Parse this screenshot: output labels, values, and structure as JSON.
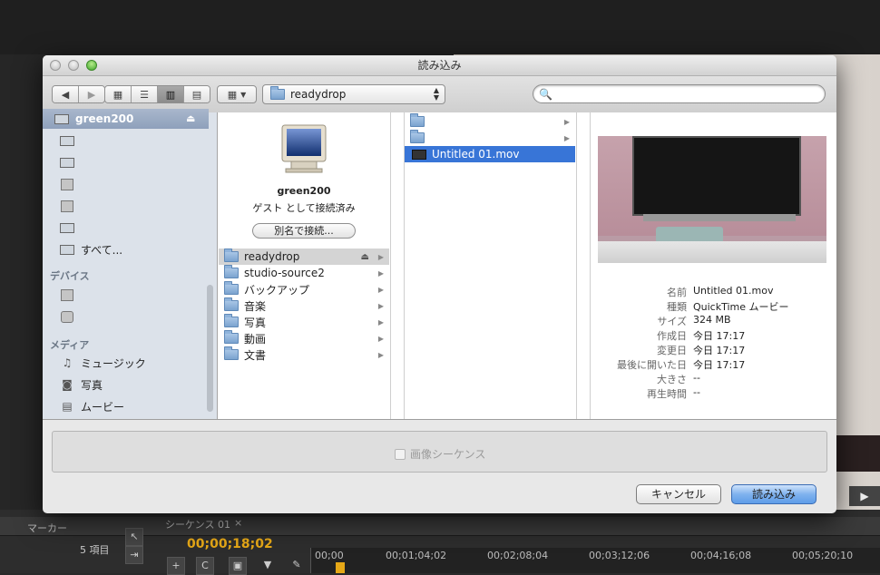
{
  "dialog": {
    "title": "読み込み",
    "path_popup": "readydrop",
    "search_placeholder": "",
    "buttons": {
      "cancel": "キャンセル",
      "import": "読み込み"
    },
    "option_checkbox": "画像シーケンス"
  },
  "sidebar": {
    "shared_host": "green200",
    "all_label": "すべて...",
    "devices_heading": "デバイス",
    "media_heading": "メディア",
    "media_items": [
      {
        "label": "ミュージック",
        "icon": "music-note-icon"
      },
      {
        "label": "写真",
        "icon": "camera-icon"
      },
      {
        "label": "ムービー",
        "icon": "film-icon"
      }
    ]
  },
  "column1": {
    "host_name": "green200",
    "host_status": "ゲスト として接続済み",
    "connect_button": "別名で接続...",
    "folders": [
      "readydrop",
      "studio-source2",
      "バックアップ",
      "音楽",
      "写真",
      "動画",
      "文書"
    ]
  },
  "column2": {
    "items": [
      {
        "label": "",
        "type": "folder"
      },
      {
        "label": "",
        "type": "folder"
      },
      {
        "label": "Untitled 01.mov",
        "type": "movie"
      }
    ]
  },
  "preview": {
    "meta": [
      {
        "key": "名前",
        "value": "Untitled 01.mov"
      },
      {
        "key": "種類",
        "value": "QuickTime ムービー"
      },
      {
        "key": "サイズ",
        "value": "324 MB"
      },
      {
        "key": "作成日",
        "value": "今日 17:17"
      },
      {
        "key": "変更日",
        "value": "今日 17:17"
      },
      {
        "key": "最後に開いた日",
        "value": "今日 17:17"
      },
      {
        "key": "大きさ",
        "value": "--"
      },
      {
        "key": "再生時間",
        "value": "--"
      }
    ]
  },
  "background": {
    "marker_tab": "マーカー",
    "sequence_tab": "シーケンス 01",
    "item_count": "5 項目",
    "timecode": "00;00;18;02",
    "ruler": [
      "00;00",
      "00;01;04;02",
      "00;02;08;04",
      "00;03;12;06",
      "00;04;16;08",
      "00;05;20;10"
    ]
  }
}
